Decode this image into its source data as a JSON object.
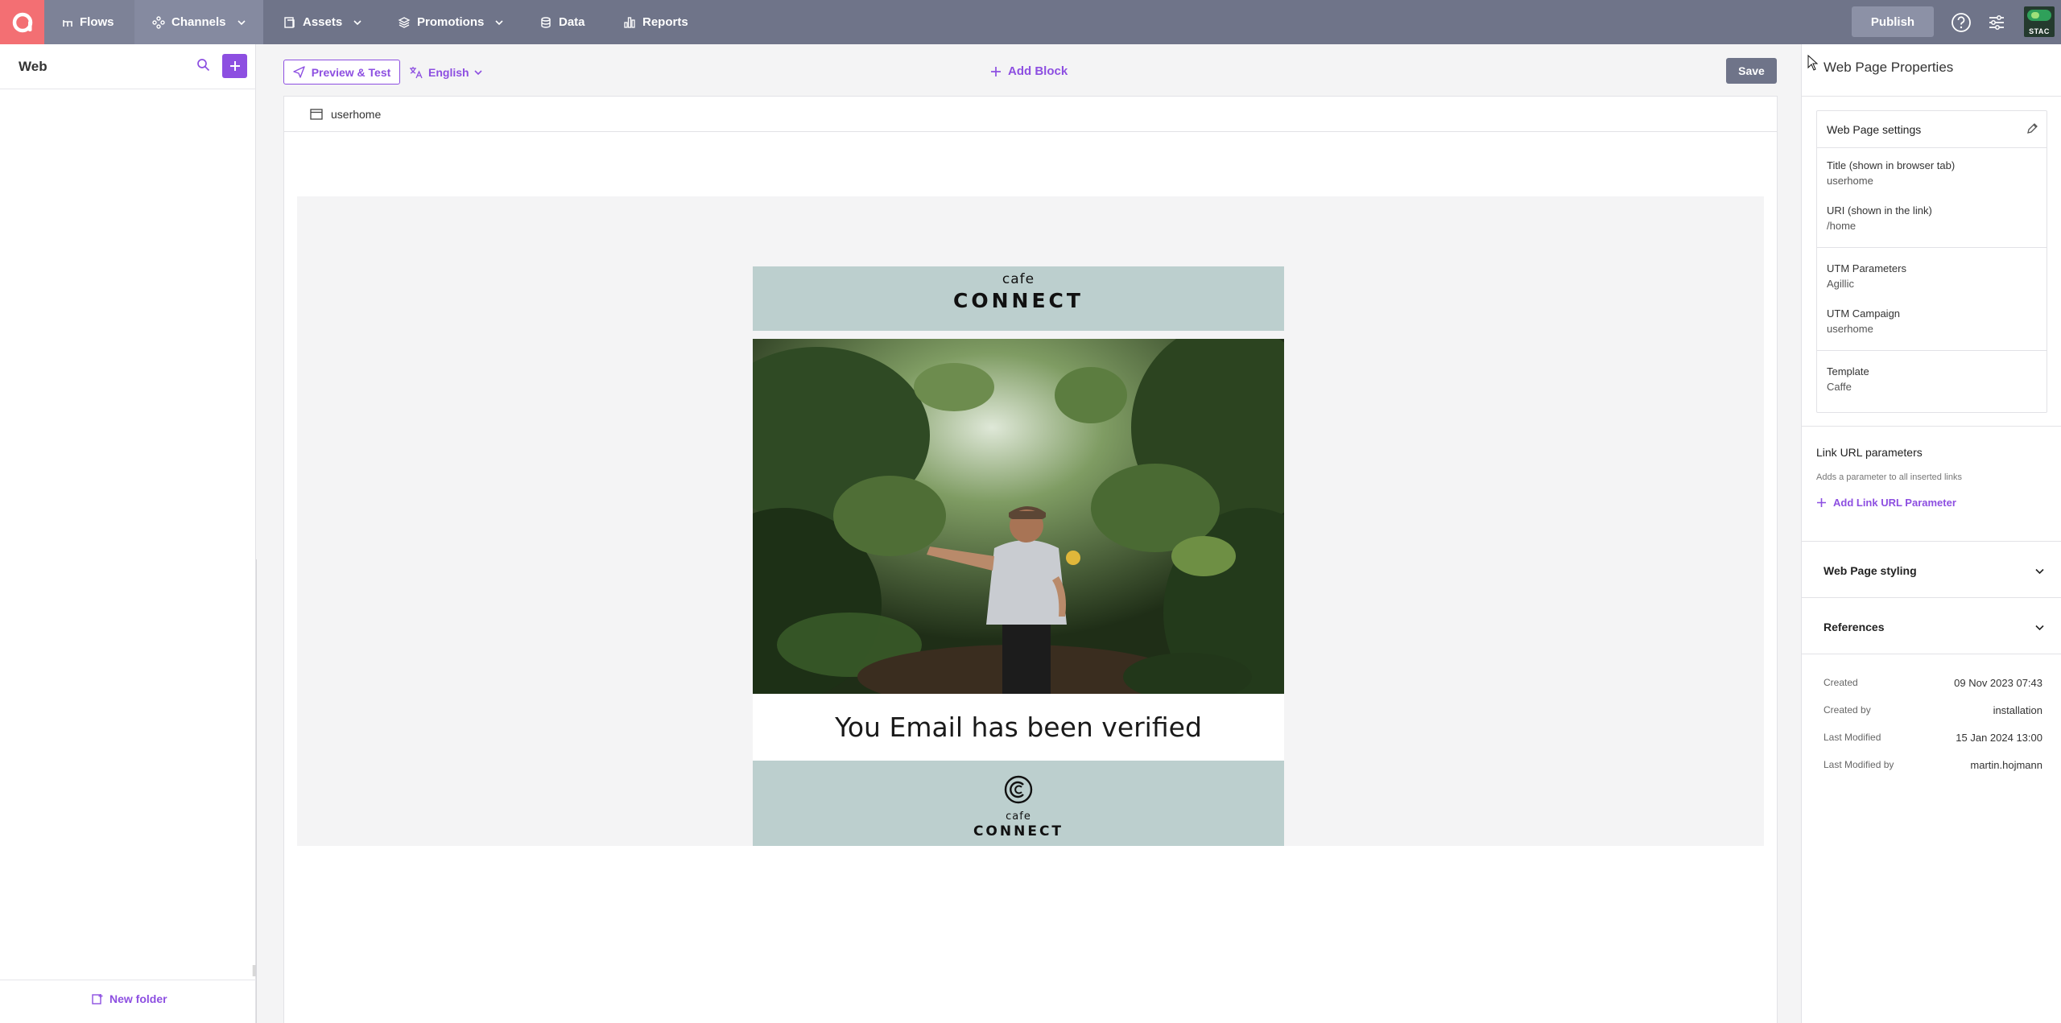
{
  "nav": {
    "items": [
      {
        "label": "Flows",
        "icon": "flows-icon"
      },
      {
        "label": "Channels",
        "icon": "channels-icon"
      },
      {
        "label": "Assets",
        "icon": "assets-icon"
      },
      {
        "label": "Promotions",
        "icon": "promotions-icon"
      },
      {
        "label": "Data",
        "icon": "data-icon"
      },
      {
        "label": "Reports",
        "icon": "reports-icon"
      }
    ],
    "publish_label": "Publish",
    "avatar_text": "STAC"
  },
  "left_panel": {
    "title": "Web",
    "new_folder_label": "New folder"
  },
  "toolbar": {
    "preview_label": "Preview & Test",
    "language_label": "English",
    "add_block_label": "Add Block",
    "save_label": "Save"
  },
  "canvas": {
    "page_name": "userhome",
    "header_small": "cafe",
    "header_big": "CONNECT",
    "headline": "You Email has been verified",
    "footer_small": "cafe",
    "footer_big": "CONNECT"
  },
  "properties": {
    "title": "Web Page Properties",
    "settings_title": "Web Page settings",
    "fields": [
      {
        "label": "Title (shown in browser tab)",
        "value": "userhome"
      },
      {
        "label": "URI (shown in the link)",
        "value": "/home"
      },
      {
        "label": "UTM Parameters",
        "value": "Agillic"
      },
      {
        "label": "UTM Campaign",
        "value": "userhome"
      },
      {
        "label": "Template",
        "value": "Caffe"
      }
    ],
    "link_url_title": "Link URL parameters",
    "link_url_sub": "Adds a parameter to all inserted links",
    "add_link_label": "Add Link URL Parameter",
    "styling_label": "Web Page styling",
    "references_label": "References",
    "meta": [
      {
        "label": "Created",
        "value": "09 Nov 2023 07:43"
      },
      {
        "label": "Created by",
        "value": "installation"
      },
      {
        "label": "Last Modified",
        "value": "15 Jan 2024 13:00"
      },
      {
        "label": "Last Modified by",
        "value": "martin.hojmann"
      }
    ]
  },
  "colors": {
    "nav_bg": "#6f7489",
    "logo": "#f36f73",
    "accent": "#8d4fe1",
    "email_band": "#bccfce"
  }
}
